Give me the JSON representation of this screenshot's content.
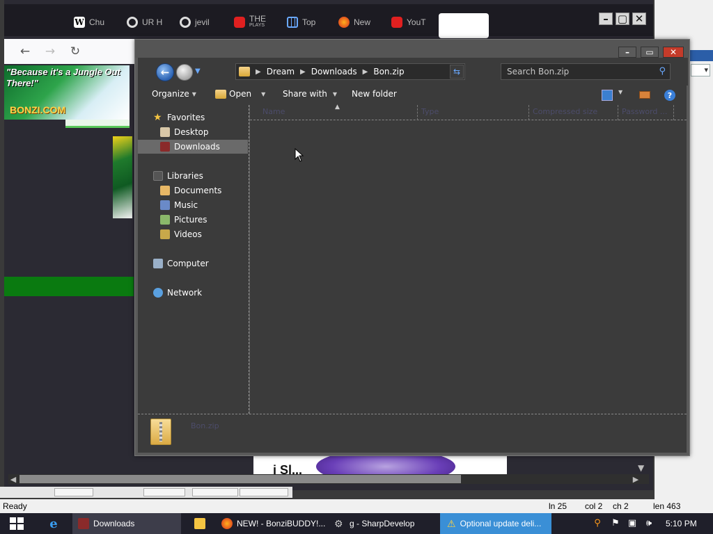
{
  "browser": {
    "tabs": [
      {
        "label": "Chu",
        "icon": "wikipedia-icon"
      },
      {
        "label": "UR H",
        "icon": "google-icon"
      },
      {
        "label": "jevil",
        "icon": "google-icon"
      },
      {
        "label": "THE",
        "sub": "PLAYS",
        "icon": "youtube-icon"
      },
      {
        "label": "Top",
        "icon": "grid-icon"
      },
      {
        "label": "New",
        "icon": "firefox-icon"
      },
      {
        "label": "YouT",
        "icon": "youtube-icon"
      }
    ],
    "banner": {
      "tagline": "\"Because it's a Jungle Out There!\"",
      "logo": "BONZI.COM"
    },
    "bottom_text": "i Sl..."
  },
  "explorer": {
    "breadcrumb": [
      "Dream",
      "Downloads",
      "Bon.zip"
    ],
    "search_placeholder": "Search Bon.zip",
    "toolbar": {
      "organize": "Organize",
      "open": "Open",
      "share_with": "Share with",
      "new_folder": "New folder"
    },
    "nav": {
      "favorites": "Favorites",
      "desktop": "Desktop",
      "downloads": "Downloads",
      "libraries": "Libraries",
      "documents": "Documents",
      "music": "Music",
      "pictures": "Pictures",
      "videos": "Videos",
      "computer": "Computer",
      "network": "Network"
    },
    "columns": [
      "Name",
      "Type",
      "Compressed size",
      "Password ..."
    ],
    "details_name": "Bon.zip"
  },
  "statusbar": {
    "status": "Ready",
    "line": "ln 25",
    "col": "col 2",
    "ch": "ch 2",
    "len": "len 463"
  },
  "taskbar": {
    "items": [
      {
        "label": "Downloads",
        "icon": "folder-icon"
      },
      {
        "label": "NEW! - BonziBUDDY!...",
        "icon": "firefox-icon"
      },
      {
        "label": "g - SharpDevelop",
        "icon": "sharpdevelop-icon"
      },
      {
        "label": "Optional update deli...",
        "icon": "warning-icon"
      }
    ],
    "clock": "5:10 PM"
  },
  "colors": {
    "accent": "#3a8fd6",
    "explorer_bg": "#3b3b3b",
    "taskbar_bg": "#1f1f2a",
    "banner_green": "#0a7a10"
  }
}
